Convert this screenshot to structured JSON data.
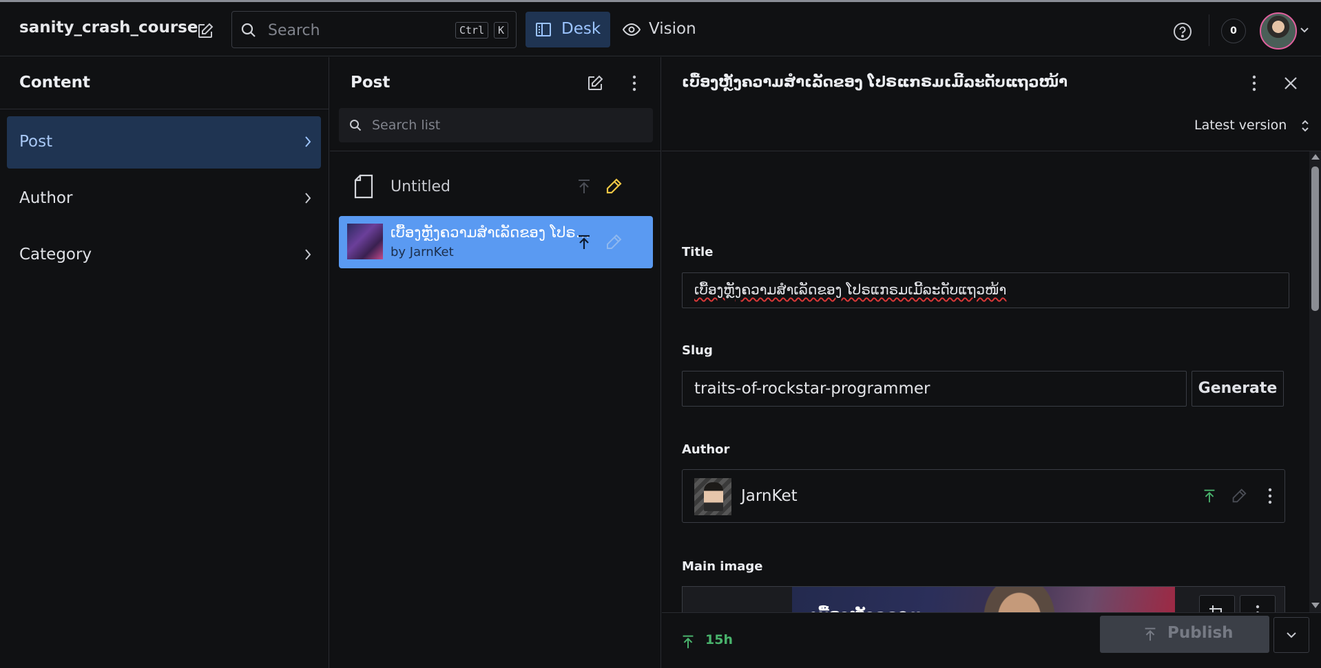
{
  "app": {
    "project_name": "sanity_crash_course",
    "search_placeholder": "Search",
    "shortcut_ctrl": "Ctrl",
    "shortcut_k": "K",
    "tools": [
      {
        "label": "Desk",
        "active": true
      },
      {
        "label": "Vision",
        "active": false
      }
    ],
    "notification_count": "0"
  },
  "content_pane": {
    "title": "Content",
    "types": [
      {
        "label": "Post",
        "active": true
      },
      {
        "label": "Author",
        "active": false
      },
      {
        "label": "Category",
        "active": false
      }
    ]
  },
  "list_pane": {
    "title": "Post",
    "search_placeholder": "Search list",
    "documents": [
      {
        "title": "Untitled",
        "subtitle": "",
        "selected": false,
        "has_thumbnail": false
      },
      {
        "title": "ເບື້ອງຫຼັງຄວາມສຳເລັດຂອງ ໂປຣແກຣມເມີ້ລະດັບແຖວໜ້າ",
        "subtitle": "by JarnKet",
        "selected": true,
        "has_thumbnail": true
      }
    ]
  },
  "editor": {
    "document_title": "ເບື້ອງຫຼັງຄວາມສຳເລັດຂອງ ໂປຣແກຣມເມີ້ລະດັບແຖວໜ້າ",
    "version_label": "Latest version",
    "fields": {
      "title_label": "Title",
      "title_value": "ເບື້ອງຫຼັງຄວາມສຳເລັດຂອງ ໂປຣແກຣມເມີ້ລະດັບແຖວໜ້າ",
      "slug_label": "Slug",
      "slug_value": "traits-of-rockstar-programmer",
      "generate_label": "Generate",
      "author_label": "Author",
      "author_value": "JarnKet",
      "main_image_label": "Main image",
      "image_text": "ເບື້ອງຫຼັງຄວາມສຳເລັດ ຂອງ ໂປຣແກຣມເມີ້ ລະດັບແຖວໜ້າ"
    },
    "footer": {
      "published_ago": "15h",
      "publish_label": "Publish"
    }
  },
  "colors": {
    "background": "#101113",
    "accent_active": "#1f3452",
    "selected_row": "#5a9af2",
    "published_green": "#49b36c",
    "edit_yellow": "#f2c744",
    "avatar_ring": "#e0609d"
  }
}
